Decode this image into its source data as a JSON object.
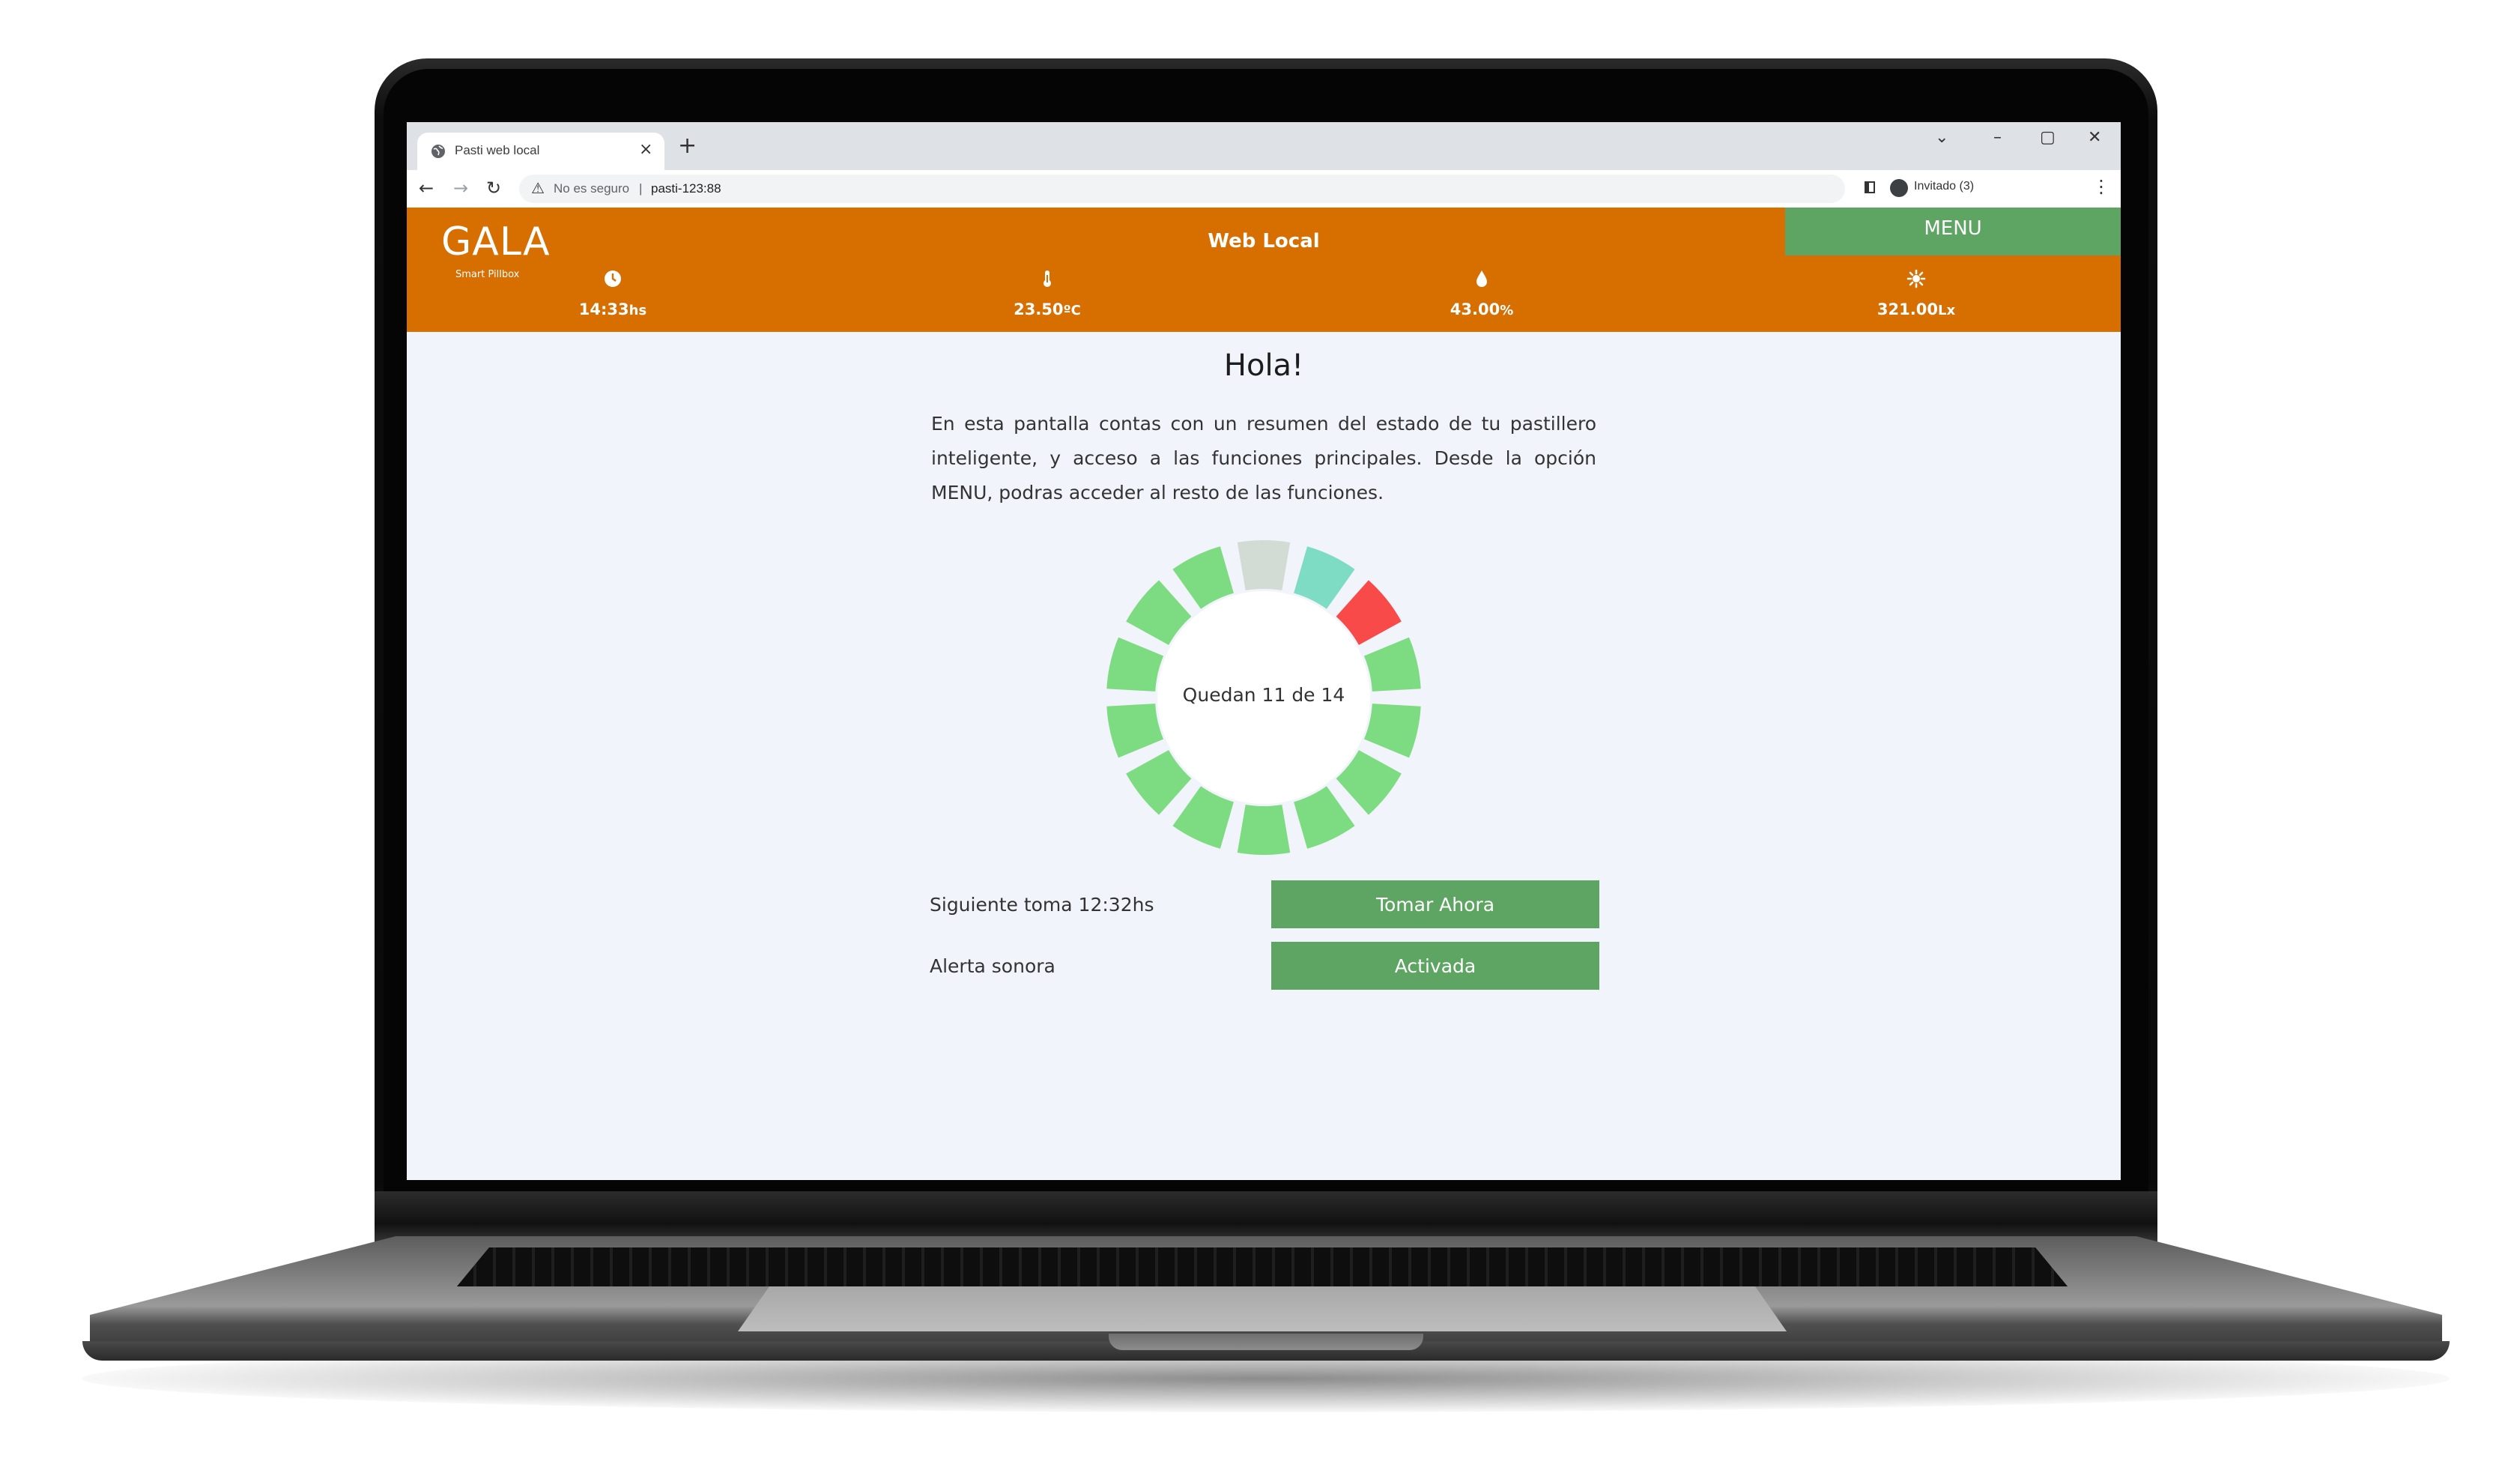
{
  "browser": {
    "tab_title": "Pasti web local",
    "tab_close": "×",
    "new_tab": "+",
    "security_label": "No es seguro",
    "separator": "|",
    "url": "pasti-123:88",
    "profile_label": "Invitado (3)",
    "window_controls": {
      "dropdown": "⌄",
      "minimize": "–",
      "maximize": "▢",
      "close": "✕"
    }
  },
  "app": {
    "brand": "GALA",
    "brand_subtitle": "Smart Pillbox",
    "title": "Web Local",
    "menu_label": "MENU",
    "accent_color": "#d66e00",
    "button_color": "#5ea462"
  },
  "stats": [
    {
      "icon": "clock-icon",
      "value": "14:33",
      "unit": "hs"
    },
    {
      "icon": "thermometer-icon",
      "value": "23.50",
      "unit": "ºC"
    },
    {
      "icon": "droplet-icon",
      "value": "43.00",
      "unit": "%"
    },
    {
      "icon": "sun-icon",
      "value": "321.00",
      "unit": "Lx"
    }
  ],
  "main": {
    "greeting": "Hola!",
    "intro": "En esta pantalla contas con un resumen del estado de tu pastillero inteligente, y acceso a las funciones principales. Desde la opción MENU, podras acceder al resto de las funciones.",
    "pill_ring": {
      "label": "Quedan 11 de 14",
      "remaining": 11,
      "total": 14,
      "slots": [
        "empty",
        "next",
        "alert",
        "taken",
        "taken",
        "taken",
        "taken",
        "taken",
        "taken",
        "taken",
        "taken",
        "taken",
        "taken",
        "taken"
      ],
      "colors": {
        "taken": "#7ddc81",
        "empty": "#d3dcd4",
        "next": "#7edcc4",
        "alert": "#f94a4a"
      }
    },
    "next_dose_label": "Siguiente toma 12:32hs",
    "take_now_button": "Tomar Ahora",
    "sound_alert_label": "Alerta sonora",
    "sound_alert_button": "Activada"
  }
}
